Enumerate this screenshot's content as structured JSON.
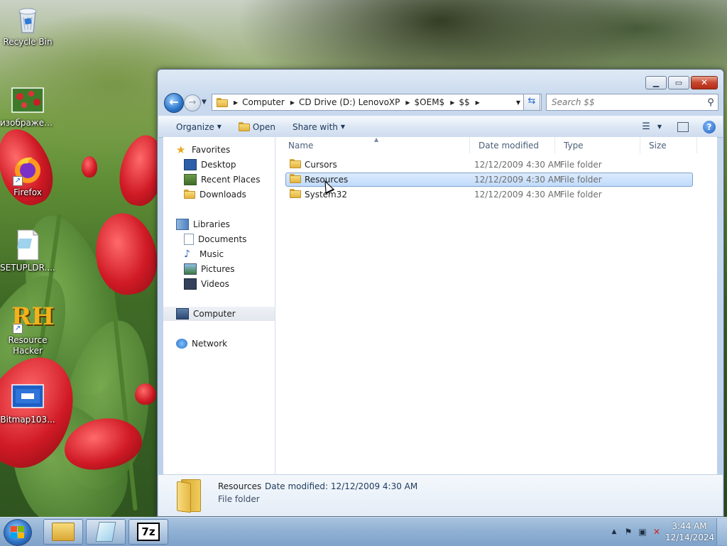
{
  "desktop": {
    "icons": [
      {
        "label": "Recycle Bin",
        "icon": "recycle-bin-icon"
      },
      {
        "label": "изображен...",
        "icon": "image-file-icon"
      },
      {
        "label": "Firefox",
        "icon": "firefox-icon"
      },
      {
        "label": "SETUPLDR....",
        "icon": "setup-file-icon"
      },
      {
        "label": "Resource Hacker",
        "icon": "resource-hacker-icon",
        "logo_text": "RH"
      },
      {
        "label": "Bitmap103...",
        "icon": "bitmap-file-icon"
      }
    ]
  },
  "window": {
    "controls": {
      "minimize": "minimize-icon",
      "maximize": "maximize-icon",
      "close": "close-icon"
    },
    "address": {
      "segments": [
        "Computer",
        "CD Drive (D:) LenovoXP",
        "$OEM$",
        "$$"
      ]
    },
    "search": {
      "placeholder": "Search $$"
    },
    "commands": {
      "organize": "Organize",
      "open": "Open",
      "share_with": "Share with"
    },
    "nav": {
      "favorites": {
        "label": "Favorites",
        "items": [
          "Desktop",
          "Recent Places",
          "Downloads"
        ]
      },
      "libraries": {
        "label": "Libraries",
        "items": [
          "Documents",
          "Music",
          "Pictures",
          "Videos"
        ]
      },
      "computer": "Computer",
      "network": "Network"
    },
    "columns": {
      "name": "Name",
      "date": "Date modified",
      "type": "Type",
      "size": "Size"
    },
    "files": [
      {
        "name": "Cursors",
        "date": "12/12/2009 4:30 AM",
        "type": "File folder",
        "selected": false
      },
      {
        "name": "Resources",
        "date": "12/12/2009 4:30 AM",
        "type": "File folder",
        "selected": true
      },
      {
        "name": "System32",
        "date": "12/12/2009 4:30 AM",
        "type": "File folder",
        "selected": false
      }
    ],
    "details": {
      "name": "Resources",
      "modified_label": "Date modified:",
      "modified_value": "12/12/2009 4:30 AM",
      "type": "File folder"
    }
  },
  "taskbar": {
    "buttons": [
      "explorer-icon",
      "notepad-icon",
      "7zip-icon"
    ],
    "sevenzip_text": "7z",
    "clock": {
      "time": "3:44 AM",
      "date": "12/14/2024"
    }
  }
}
